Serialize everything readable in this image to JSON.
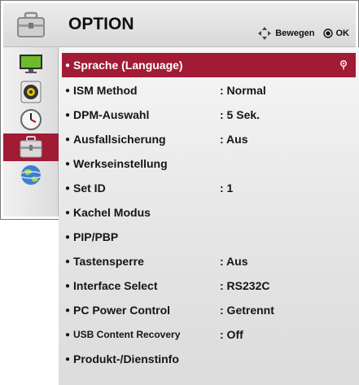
{
  "header": {
    "title": "OPTION",
    "move_label": "Bewegen",
    "ok_label": "OK",
    "icon": "option-briefcase-icon"
  },
  "sidebar": {
    "items": [
      {
        "icon": "picture-monitor-icon",
        "active": false
      },
      {
        "icon": "audio-speaker-icon",
        "active": false
      },
      {
        "icon": "clock-icon",
        "active": false
      },
      {
        "icon": "option-briefcase-icon",
        "active": true
      },
      {
        "icon": "network-globe-icon",
        "active": false
      }
    ]
  },
  "menu": {
    "items": [
      {
        "label": "Sprache (Language)",
        "value": "",
        "selected": true
      },
      {
        "label": "ISM Method",
        "value": ": Normal"
      },
      {
        "label": "DPM-Auswahl",
        "value": ": 5 Sek."
      },
      {
        "label": "Ausfallsicherung",
        "value": ": Aus"
      },
      {
        "label": "Werkseinstellung",
        "value": ""
      },
      {
        "label": "Set ID",
        "value": ": 1"
      },
      {
        "label": "Kachel Modus",
        "value": ""
      },
      {
        "label": "PIP/PBP",
        "value": ""
      },
      {
        "label": "Tastensperre",
        "value": ": Aus"
      },
      {
        "label": "Interface Select",
        "value": ": RS232C"
      },
      {
        "label": "PC Power Control",
        "value": ": Getrennt"
      },
      {
        "label": "USB Content Recovery",
        "value": ": Off"
      },
      {
        "label": "Produkt-/Dienstinfo",
        "value": ""
      }
    ]
  },
  "colors": {
    "selection": "#a11b35",
    "panel": "#e4e4e4"
  }
}
